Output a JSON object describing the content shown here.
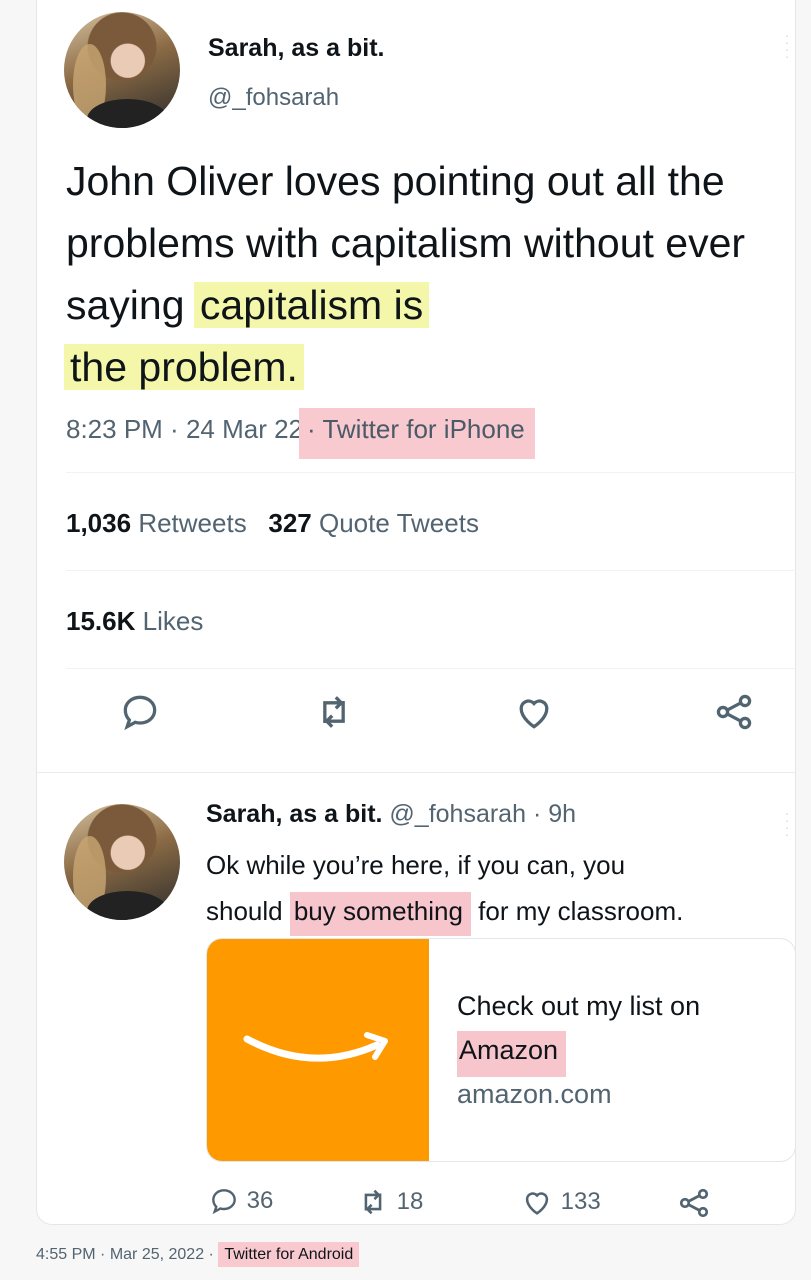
{
  "main_tweet": {
    "author_name": "Sarah, as a bit.",
    "author_handle": "@_fohsarah",
    "text_plain": "John Oliver loves pointing out all the problems with capitalism without ever saying ",
    "text_highlight_1": "capitalism is",
    "text_highlight_2": "the problem.",
    "time": "8:23 PM",
    "sep1": " · ",
    "date": "24 Mar 22",
    "sep2": " · ",
    "source": "Twitter for iPhone",
    "retweets_count": "1,036",
    "retweets_label": "Retweets",
    "quote_count": "327",
    "quote_label": "Quote Tweets",
    "likes_count": "15.6K",
    "likes_label": "Likes"
  },
  "reply_tweet": {
    "author_name": "Sarah, as a bit.",
    "author_handle": "@_fohsarah",
    "age": "· 9h",
    "text_line1": "Ok while you’re here, if you can, you",
    "text_line2_before": "should ",
    "text_line2_highlight": "buy something",
    "text_line2_after": " for my classroom.",
    "link_card": {
      "title": "Check out my list on",
      "title_highlight": "Amazon",
      "domain": "amazon.com"
    },
    "reply_count": "36",
    "retweet_count": "18",
    "like_count": "133"
  },
  "footer": {
    "time": "4:55 PM",
    "sep1": " · ",
    "date": "Mar 25, 2022",
    "sep2": " · ",
    "source": "Twitter for Android"
  },
  "colors": {
    "highlight_yellow": "#f4f7a9",
    "highlight_pink": "#f7c5cc",
    "amazon_orange": "#ff9900",
    "text_secondary": "#536471"
  },
  "icons": [
    "reply-icon",
    "retweet-icon",
    "like-icon",
    "share-icon",
    "more-icon",
    "amazon-smile-icon"
  ]
}
